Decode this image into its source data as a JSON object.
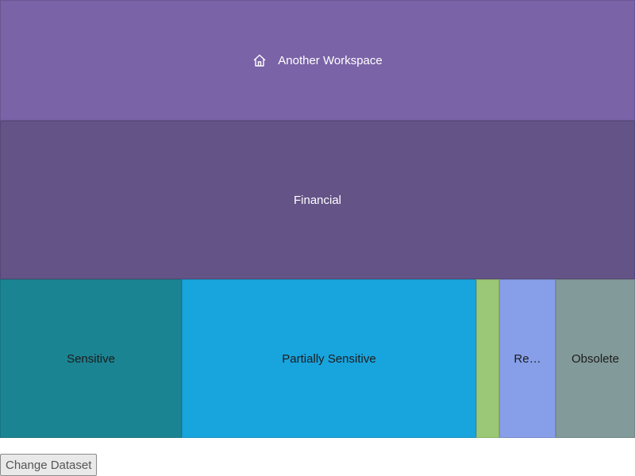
{
  "treemap": {
    "root": {
      "label": "Another Workspace",
      "icon": "home-icon",
      "color": "#7a63a7"
    },
    "parent": {
      "label": "Financial",
      "color": "#645387"
    },
    "children": [
      {
        "label": "Sensitive",
        "color": "#1b8492"
      },
      {
        "label": "Partially Sensitive",
        "color": "#18a4dd"
      },
      {
        "label": "",
        "color": "#9bc876"
      },
      {
        "label": "Re…",
        "color": "#879ee8"
      },
      {
        "label": "Obsolete",
        "color": "#839a9a"
      }
    ]
  },
  "controls": {
    "change_dataset_label": "Change Dataset"
  }
}
